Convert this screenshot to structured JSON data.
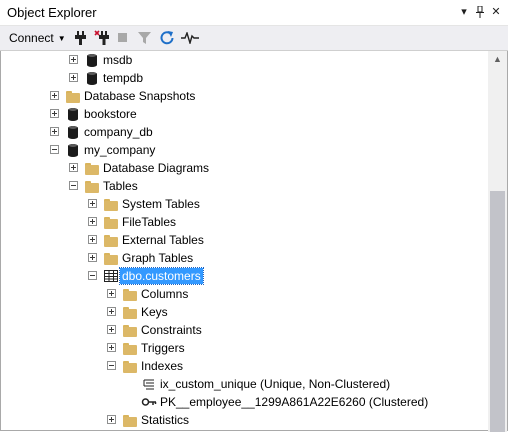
{
  "window": {
    "title": "Object Explorer",
    "dropdown_glyph": "▾",
    "pin_glyph": "📌",
    "close_glyph": "✕"
  },
  "toolbar": {
    "connect_label": "Connect",
    "icons": [
      "connect-plug-icon",
      "disconnect-plug-icon",
      "stop-icon",
      "filter-icon",
      "refresh-icon",
      "activity-monitor-icon"
    ]
  },
  "tree": {
    "items": [
      {
        "label": "msdb",
        "type": "database",
        "expander": "plus"
      },
      {
        "label": "tempdb",
        "type": "database",
        "expander": "plus"
      },
      {
        "label": "Database Snapshots",
        "type": "folder",
        "expander": "plus"
      },
      {
        "label": "bookstore",
        "type": "database",
        "expander": "plus"
      },
      {
        "label": "company_db",
        "type": "database",
        "expander": "plus"
      },
      {
        "label": "my_company",
        "type": "database",
        "expander": "minus"
      },
      {
        "label": "Database Diagrams",
        "type": "folder",
        "expander": "plus"
      },
      {
        "label": "Tables",
        "type": "folder",
        "expander": "minus"
      },
      {
        "label": "System Tables",
        "type": "folder",
        "expander": "plus"
      },
      {
        "label": "FileTables",
        "type": "folder",
        "expander": "plus"
      },
      {
        "label": "External Tables",
        "type": "folder",
        "expander": "plus"
      },
      {
        "label": "Graph Tables",
        "type": "folder",
        "expander": "plus"
      },
      {
        "label": "dbo.customers",
        "type": "table",
        "expander": "minus",
        "selected": true
      },
      {
        "label": "Columns",
        "type": "folder",
        "expander": "plus"
      },
      {
        "label": "Keys",
        "type": "folder",
        "expander": "plus"
      },
      {
        "label": "Constraints",
        "type": "folder",
        "expander": "plus"
      },
      {
        "label": "Triggers",
        "type": "folder",
        "expander": "plus"
      },
      {
        "label": "Indexes",
        "type": "folder",
        "expander": "minus"
      },
      {
        "label": "ix_custom_unique (Unique, Non-Clustered)",
        "type": "index",
        "expander": "none"
      },
      {
        "label": "PK__employee__1299A861A22E6260 (Clustered)",
        "type": "primary-key",
        "expander": "none"
      },
      {
        "label": "Statistics",
        "type": "folder",
        "expander": "plus"
      }
    ]
  },
  "colors": {
    "selection": "#3399ff",
    "folder": "#dcb867",
    "toolbar_bg": "#eeeef2",
    "refresh_blue": "#1e6fc8"
  }
}
